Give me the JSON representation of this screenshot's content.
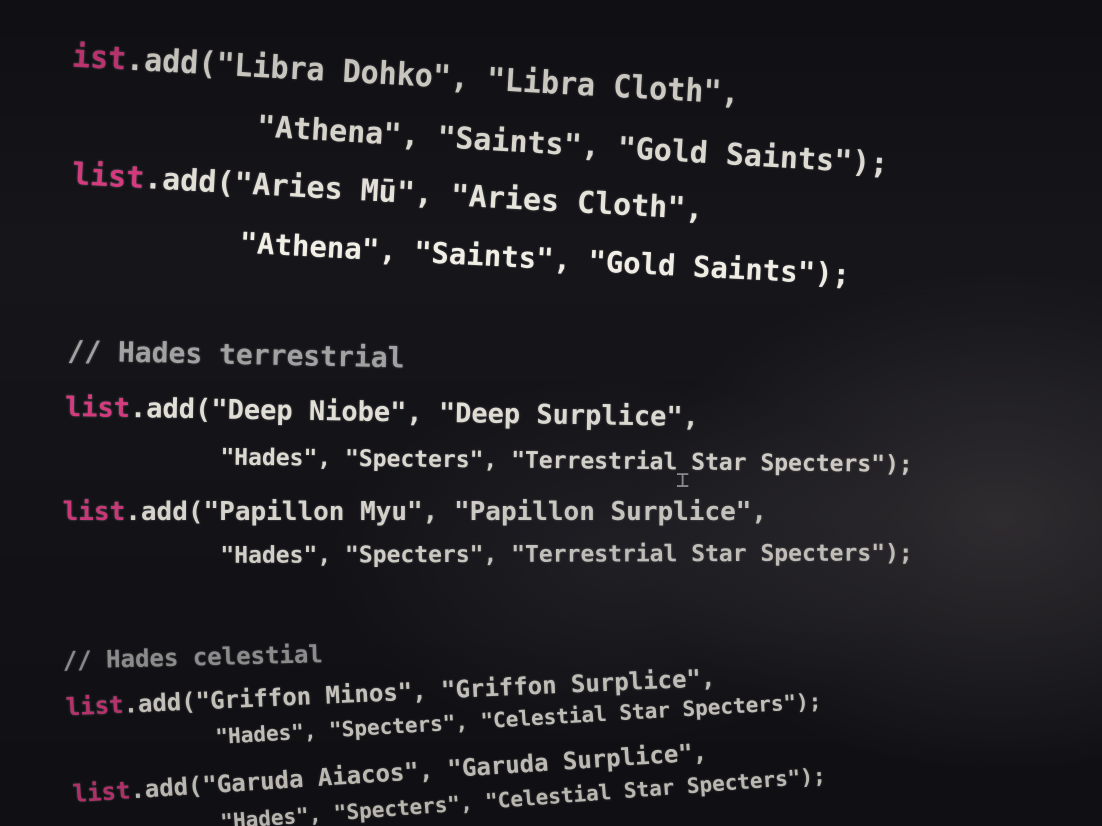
{
  "editor": {
    "lines": [
      {
        "kw": "ist",
        "call": ".add(",
        "text": "\"Libra Dohko\", \"Libra Cloth\","
      },
      {
        "kw": "",
        "call": "",
        "text": "\"Athena\", \"Saints\", \"Gold Saints\");"
      },
      {
        "kw": "list",
        "call": ".add(",
        "text": "\"Aries Mū\", \"Aries Cloth\","
      },
      {
        "kw": "",
        "call": "",
        "text": "\"Athena\", \"Saints\", \"Gold Saints\");"
      },
      {
        "comment": "// Hades terrestrial"
      },
      {
        "kw": "list",
        "call": ".add(",
        "text": "\"Deep Niobe\", \"Deep Surplice\","
      },
      {
        "kw": "",
        "call": "",
        "text": "\"Hades\", \"Specters\", \"Terrestrial Star Specters\");"
      },
      {
        "kw": "list",
        "call": ".add(",
        "text": "\"Papillon Myu\", \"Papillon Surplice\","
      },
      {
        "kw": "",
        "call": "",
        "text": "\"Hades\", \"Specters\", \"Terrestrial Star Specters\");"
      },
      {
        "comment": "// Hades celestial"
      },
      {
        "kw": "list",
        "call": ".add(",
        "text": "\"Griffon Minos\", \"Griffon Surplice\","
      },
      {
        "kw": "",
        "call": "",
        "text": "\"Hades\", \"Specters\", \"Celestial Star Specters\");"
      },
      {
        "kw": "list",
        "call": ".add(",
        "text": "\"Garuda Aiacos\", \"Garuda Surplice\","
      },
      {
        "kw": "",
        "call": "",
        "text": "\"Hades\", \"Specters\", \"Celestial Star Specters\");"
      }
    ]
  },
  "colors": {
    "background": "#15151a",
    "keyword": "#e43f88",
    "text": "#f2efe6",
    "comment": "#a9a9a9"
  },
  "icons": {
    "text_cursor": "i-beam-cursor-icon"
  }
}
